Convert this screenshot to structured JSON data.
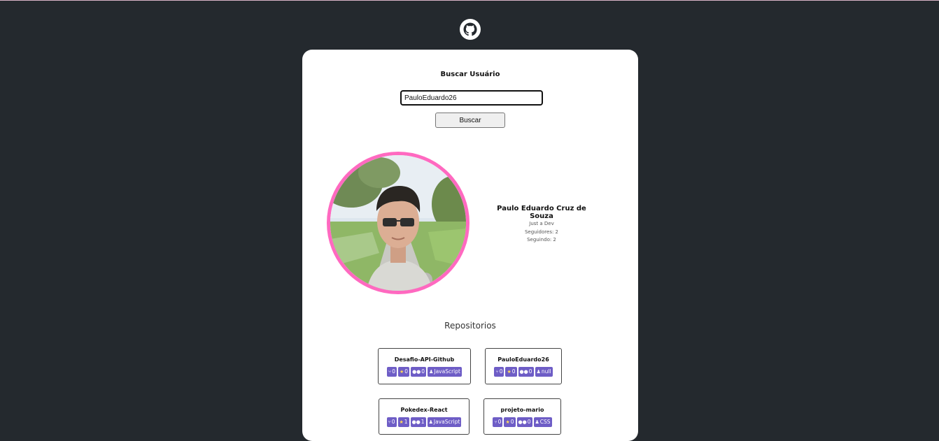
{
  "colors": {
    "background": "#24292e",
    "card": "#ffffff",
    "accent_pink": "#ff69c0",
    "badge": "#6e5dc6"
  },
  "header": {
    "logo_icon": "github-octocat-icon"
  },
  "search": {
    "title": "Buscar Usuário",
    "value": "PauloEduardo26",
    "button_label": "Buscar"
  },
  "profile": {
    "name": "Paulo Eduardo Cruz de Souza",
    "bio": "Just a Dev",
    "followers": "Seguidores: 2",
    "following": "Seguindo: 2"
  },
  "repos": {
    "title": "Repositorios",
    "items": [
      {
        "name": "Desafio-API-Github",
        "forks": "0",
        "stars": "0",
        "watchers": "0",
        "language": "JavaScript"
      },
      {
        "name": "PauloEduardo26",
        "forks": "0",
        "stars": "0",
        "watchers": "0",
        "language": "null"
      },
      {
        "name": "Pokedex-React",
        "forks": "0",
        "stars": "1",
        "watchers": "1",
        "language": "JavaScript"
      },
      {
        "name": "projeto-mario",
        "forks": "0",
        "stars": "0",
        "watchers": "0",
        "language": "CSS"
      }
    ]
  }
}
